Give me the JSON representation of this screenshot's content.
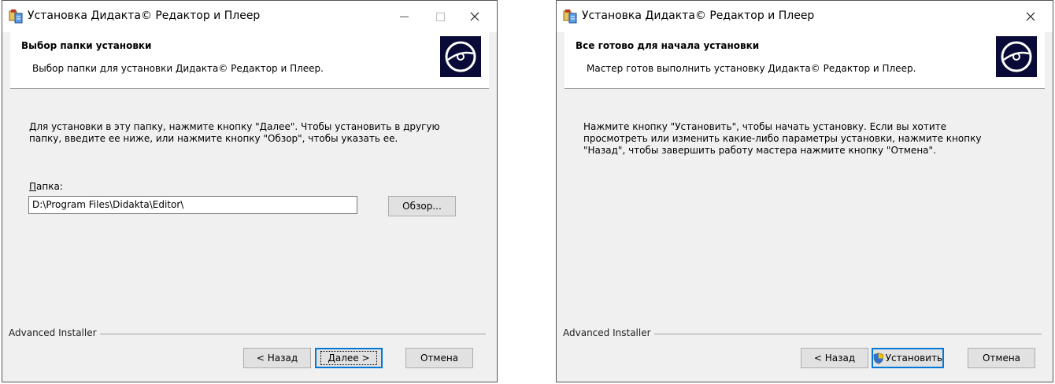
{
  "left_window": {
    "title": "Установка Дидакта© Редактор и Плеер",
    "banner_title": "Выбор папки установки",
    "banner_subtitle": "Выбор папки для установки Дидакта© Редактор и Плеер.",
    "instructions_line1": "Для установки в эту папку, нажмите кнопку \"Далее\". Чтобы установить в другую",
    "instructions_line2": "папку, введите ее ниже, или нажмите кнопку \"Обзор\", чтобы указать ее.",
    "folder_label_first": "П",
    "folder_label_rest": "апка:",
    "folder_value": "D:\\Program Files\\Didakta\\Editor\\",
    "browse_label": "Обзор...",
    "footer_brand": "Advanced Installer",
    "back_label": "< Назад",
    "next_label": "Далее >",
    "cancel_label": "Отмена"
  },
  "right_window": {
    "title": "Установка Дидакта© Редактор и Плеер",
    "banner_title": "Все готово для начала установки",
    "banner_subtitle": "Мастер готов выполнить установку Дидакта© Редактор и Плеер.",
    "instructions_line1": "Нажмите кнопку \"Установить\", чтобы начать установку. Если вы хотите",
    "instructions_line2": "просмотреть или изменить какие-либо параметры установки, нажмите кнопку",
    "instructions_line3": "\"Назад\", чтобы завершить работу мастера нажмите кнопку \"Отмена\".",
    "footer_brand": "Advanced Installer",
    "back_label": "< Назад",
    "install_label": "Установить",
    "cancel_label": "Отмена"
  },
  "icons": {
    "app": "installer-app-icon",
    "banner": "disc-icon",
    "install": "uac-shield-icon",
    "minimize": "minimize-icon",
    "maximize": "maximize-icon",
    "close": "close-icon"
  },
  "colors": {
    "window_bg": "#f0f0f0",
    "banner_bg": "#ffffff",
    "disc_bg": "#0a0a38",
    "default_button_border": "#0078d7"
  }
}
